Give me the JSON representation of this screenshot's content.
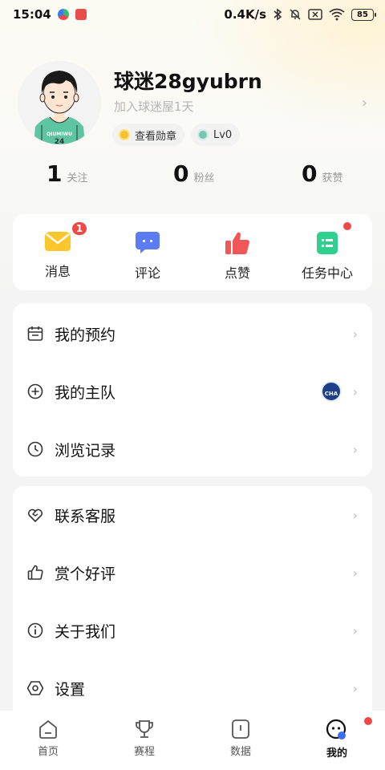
{
  "status_bar": {
    "time": "15:04",
    "network_speed": "0.4K/s",
    "battery": "85"
  },
  "profile": {
    "name": "球迷28gyubrn",
    "join_text": "加入球迷屋1天",
    "medal_label": "查看勋章",
    "level_label": "Lv0",
    "jersey_text": "QIUMIWU",
    "jersey_number": "24"
  },
  "stats": [
    {
      "value": "1",
      "label": "关注"
    },
    {
      "value": "0",
      "label": "粉丝"
    },
    {
      "value": "0",
      "label": "获赞"
    }
  ],
  "quick_actions": [
    {
      "label": "消息",
      "badge": "1",
      "icon": "envelope-icon",
      "color": "#f9c62c"
    },
    {
      "label": "评论",
      "icon": "comment-icon",
      "color": "#5b7cf5"
    },
    {
      "label": "点赞",
      "icon": "thumbs-up-icon",
      "color": "#f25757"
    },
    {
      "label": "任务中心",
      "icon": "task-icon",
      "color": "#2fcf8c"
    }
  ],
  "menu_group_1": [
    {
      "label": "我的预约",
      "icon": "calendar-icon"
    },
    {
      "label": "我的主队",
      "icon": "plus-circle-icon",
      "team_logo_text": "CHA"
    },
    {
      "label": "浏览记录",
      "icon": "clock-icon"
    }
  ],
  "menu_group_2": [
    {
      "label": "联系客服",
      "icon": "heart-handshake-icon"
    },
    {
      "label": "赏个好评",
      "icon": "thumbs-up-outline-icon"
    },
    {
      "label": "关于我们",
      "icon": "info-icon"
    },
    {
      "label": "设置",
      "icon": "settings-icon"
    }
  ],
  "bottom_nav": [
    {
      "label": "首页",
      "icon": "home-icon"
    },
    {
      "label": "赛程",
      "icon": "trophy-icon"
    },
    {
      "label": "数据",
      "icon": "data-icon"
    },
    {
      "label": "我的",
      "icon": "profile-face-icon",
      "active": true
    }
  ]
}
